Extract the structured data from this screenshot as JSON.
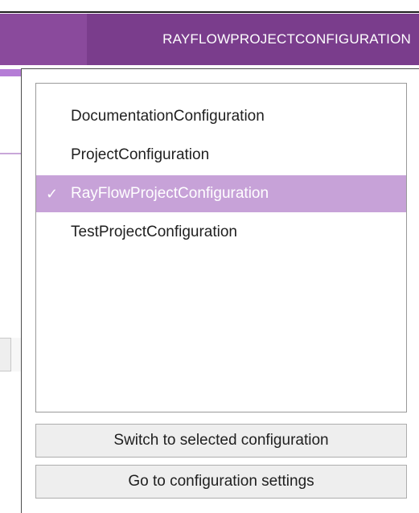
{
  "window": {
    "title": "RAYFLOWPROJECTCONFIGURATION"
  },
  "colors": {
    "accent": "#7a3d8c",
    "selection": "#c7a2d8"
  },
  "configurations": [
    {
      "label": "DocumentationConfiguration",
      "selected": false
    },
    {
      "label": "ProjectConfiguration",
      "selected": false
    },
    {
      "label": "RayFlowProjectConfiguration",
      "selected": true,
      "check": "✓"
    },
    {
      "label": "TestProjectConfiguration",
      "selected": false
    }
  ],
  "actions": {
    "switch_label": "Switch to selected configuration",
    "settings_label": "Go to configuration settings"
  }
}
